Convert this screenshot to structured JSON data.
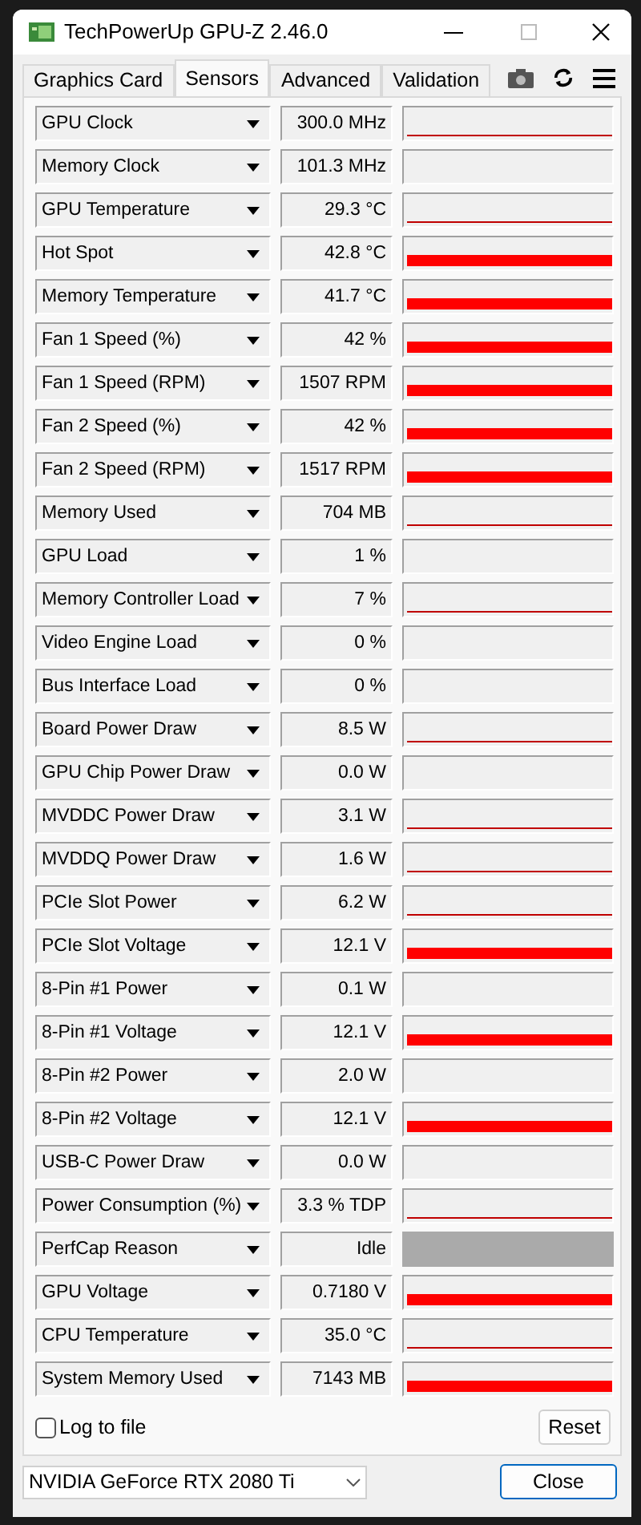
{
  "window": {
    "title": "TechPowerUp GPU-Z 2.46.0"
  },
  "tabs": [
    {
      "label": "Graphics Card",
      "selected": false
    },
    {
      "label": "Sensors",
      "selected": true
    },
    {
      "label": "Advanced",
      "selected": false
    },
    {
      "label": "Validation",
      "selected": false
    }
  ],
  "sensors": [
    {
      "name": "GPU Clock",
      "value": "300.0 MHz",
      "kind": "line"
    },
    {
      "name": "Memory Clock",
      "value": "101.3 MHz",
      "kind": "empty"
    },
    {
      "name": "GPU Temperature",
      "value": "29.3 °C",
      "kind": "line"
    },
    {
      "name": "Hot Spot",
      "value": "42.8 °C",
      "kind": "bar"
    },
    {
      "name": "Memory Temperature",
      "value": "41.7 °C",
      "kind": "bar"
    },
    {
      "name": "Fan 1 Speed (%)",
      "value": "42 %",
      "kind": "bar"
    },
    {
      "name": "Fan 1 Speed (RPM)",
      "value": "1507 RPM",
      "kind": "bar"
    },
    {
      "name": "Fan 2 Speed (%)",
      "value": "42 %",
      "kind": "bar"
    },
    {
      "name": "Fan 2 Speed (RPM)",
      "value": "1517 RPM",
      "kind": "bar"
    },
    {
      "name": "Memory Used",
      "value": "704 MB",
      "kind": "line"
    },
    {
      "name": "GPU Load",
      "value": "1 %",
      "kind": "empty"
    },
    {
      "name": "Memory Controller Load",
      "value": "7 %",
      "kind": "line"
    },
    {
      "name": "Video Engine Load",
      "value": "0 %",
      "kind": "empty"
    },
    {
      "name": "Bus Interface Load",
      "value": "0 %",
      "kind": "empty"
    },
    {
      "name": "Board Power Draw",
      "value": "8.5 W",
      "kind": "line"
    },
    {
      "name": "GPU Chip Power Draw",
      "value": "0.0 W",
      "kind": "empty"
    },
    {
      "name": "MVDDC Power Draw",
      "value": "3.1 W",
      "kind": "line"
    },
    {
      "name": "MVDDQ Power Draw",
      "value": "1.6 W",
      "kind": "line"
    },
    {
      "name": "PCIe Slot Power",
      "value": "6.2 W",
      "kind": "line"
    },
    {
      "name": "PCIe Slot Voltage",
      "value": "12.1 V",
      "kind": "bar"
    },
    {
      "name": "8-Pin #1 Power",
      "value": "0.1 W",
      "kind": "empty"
    },
    {
      "name": "8-Pin #1 Voltage",
      "value": "12.1 V",
      "kind": "bar"
    },
    {
      "name": "8-Pin #2 Power",
      "value": "2.0 W",
      "kind": "empty"
    },
    {
      "name": "8-Pin #2 Voltage",
      "value": "12.1 V",
      "kind": "bar"
    },
    {
      "name": "USB-C Power Draw",
      "value": "0.0 W",
      "kind": "empty"
    },
    {
      "name": "Power Consumption (%)",
      "value": "3.3 % TDP",
      "kind": "line"
    },
    {
      "name": "PerfCap Reason",
      "value": "Idle",
      "kind": "status",
      "color": "#aaaaaa"
    },
    {
      "name": "GPU Voltage",
      "value": "0.7180 V",
      "kind": "bar"
    },
    {
      "name": "CPU Temperature",
      "value": "35.0 °C",
      "kind": "line"
    },
    {
      "name": "System Memory Used",
      "value": "7143 MB",
      "kind": "bar"
    }
  ],
  "log_to_file": {
    "label": "Log to file",
    "checked": false
  },
  "reset_button": "Reset",
  "gpu_select": {
    "value": "NVIDIA GeForce RTX 2080 Ti"
  },
  "close_button": "Close"
}
